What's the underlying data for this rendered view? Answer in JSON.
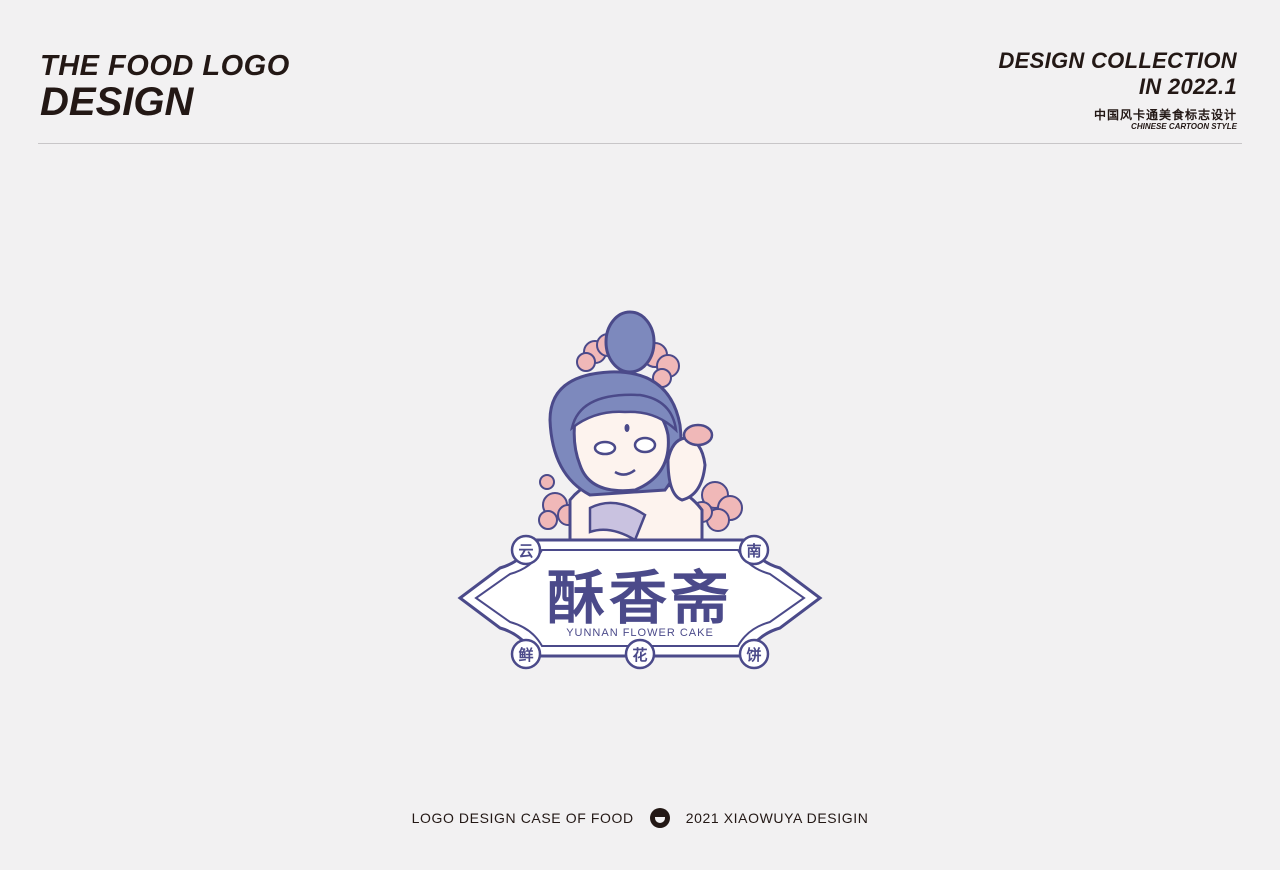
{
  "header": {
    "left_line1": "THE FOOD LOGO",
    "left_line2": "DESIGN",
    "right_line1": "DESIGN COLLECTION",
    "right_line2": "IN 2022.1",
    "right_cn": "中国风卡通美食标志设计",
    "right_en": "CHINESE CARTOON STYLE"
  },
  "logo": {
    "brand_name": "酥香斋",
    "subtitle": "YUNNAN FLOWER CAKE",
    "top_badges": [
      "云",
      "南"
    ],
    "bottom_badges": [
      "鲜",
      "花",
      "饼"
    ],
    "colors": {
      "primary": "#4b4a8a",
      "hair": "#7d89bd",
      "flower": "#f0b8b8",
      "skin": "#fdf3ee"
    }
  },
  "footer": {
    "left_text": "LOGO DESIGN CASE OF FOOD",
    "right_text": "2021 XIAOWUYA DESIGIN",
    "icon": "mascot-icon"
  }
}
